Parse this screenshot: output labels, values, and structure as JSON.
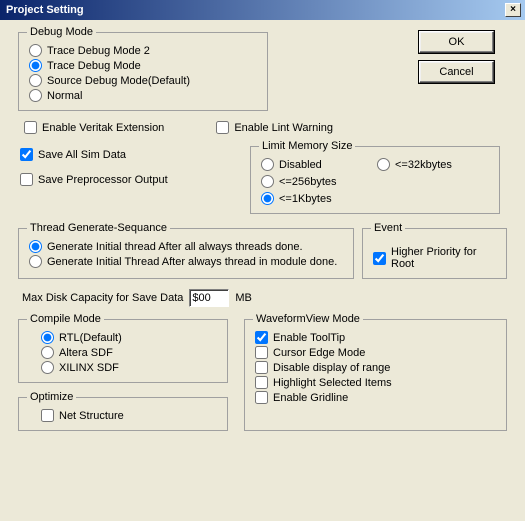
{
  "title": "Project Setting",
  "close_glyph": "×",
  "buttons": {
    "ok": "OK",
    "cancel": "Cancel"
  },
  "debug_mode": {
    "legend": "Debug Mode",
    "opts": [
      "Trace Debug Mode 2",
      "Trace Debug Mode",
      "Source Debug Mode(Default)",
      "Normal"
    ],
    "selected": 1
  },
  "flags": {
    "enable_veritak": "Enable Veritak Extension",
    "save_all_sim": "Save All Sim Data",
    "save_preproc": "Save Preprocessor Output",
    "enable_lint": "Enable Lint Warning"
  },
  "flags_state": {
    "enable_veritak": false,
    "save_all_sim": true,
    "save_preproc": false,
    "enable_lint": false
  },
  "limit_mem": {
    "legend": "Limit Memory Size",
    "opts": [
      "Disabled",
      "<=32kbytes",
      "<=256bytes",
      "<=1Kbytes"
    ],
    "selected": 3
  },
  "tge": {
    "legend": "Thread Generate-Sequance",
    "opts": [
      "Generate Initial thread After all always threads done.",
      "Generate Initial Thread After always thread in module done."
    ],
    "selected": 0
  },
  "event": {
    "legend": "Event",
    "higher_priority": "Higher Priority for Root",
    "checked": true
  },
  "max_disk": {
    "label": "Max Disk Capacity for Save Data",
    "value": "$00",
    "unit": "MB"
  },
  "compile_mode": {
    "legend": "Compile Mode",
    "opts": [
      "RTL(Default)",
      "Altera SDF",
      "XILINX SDF"
    ],
    "selected": 0
  },
  "optimize": {
    "legend": "Optimize",
    "net_structure": "Net Structure",
    "checked": false
  },
  "waveform": {
    "legend": "WaveformView Mode",
    "opts": [
      "Enable ToolTip",
      "Cursor Edge Mode",
      "Disable display of range",
      "Highlight Selected Items",
      "Enable Gridline"
    ],
    "checked": [
      true,
      false,
      false,
      false,
      false
    ]
  }
}
